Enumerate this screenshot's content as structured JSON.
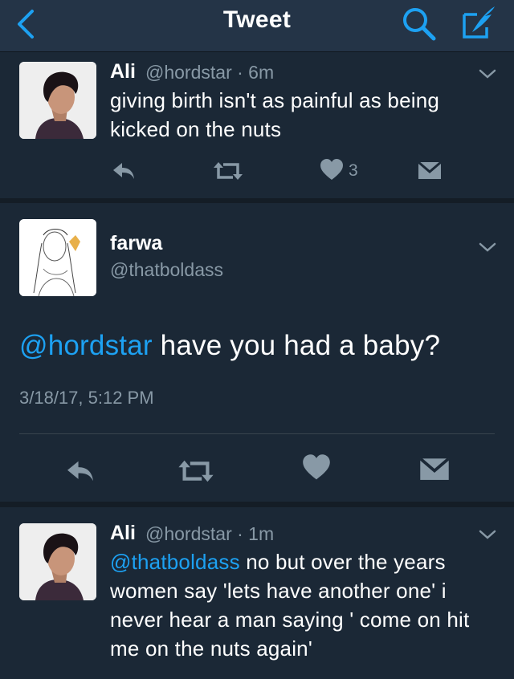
{
  "navbar": {
    "title": "Tweet"
  },
  "tweets": [
    {
      "name": "Ali",
      "handle": "@hordstar",
      "time": " · 6m",
      "text": "giving birth isn't as painful as being kicked on the nuts",
      "like_count": "3"
    },
    {
      "name": "farwa",
      "handle": "@thatboldass",
      "mention": "@hordstar",
      "text": " have you had a baby?",
      "timestamp": "3/18/17, 5:12 PM"
    },
    {
      "name": "Ali",
      "handle": "@hordstar",
      "time": " · 1m",
      "mention": "@thatboldass",
      "text": " no but over the years women say 'lets have another one' i never hear a man saying ' come on hit me on the nuts again'"
    }
  ],
  "colors": {
    "background": "#141d26",
    "card": "#1b2836",
    "navbar": "#243447",
    "accent": "#1da1f2",
    "secondary_text": "#8899a6",
    "icon": "#8899a6"
  },
  "icons": [
    "back-chevron-icon",
    "search-icon",
    "compose-icon",
    "chevron-down-icon",
    "reply-icon",
    "retweet-icon",
    "heart-icon",
    "direct-message-icon"
  ]
}
